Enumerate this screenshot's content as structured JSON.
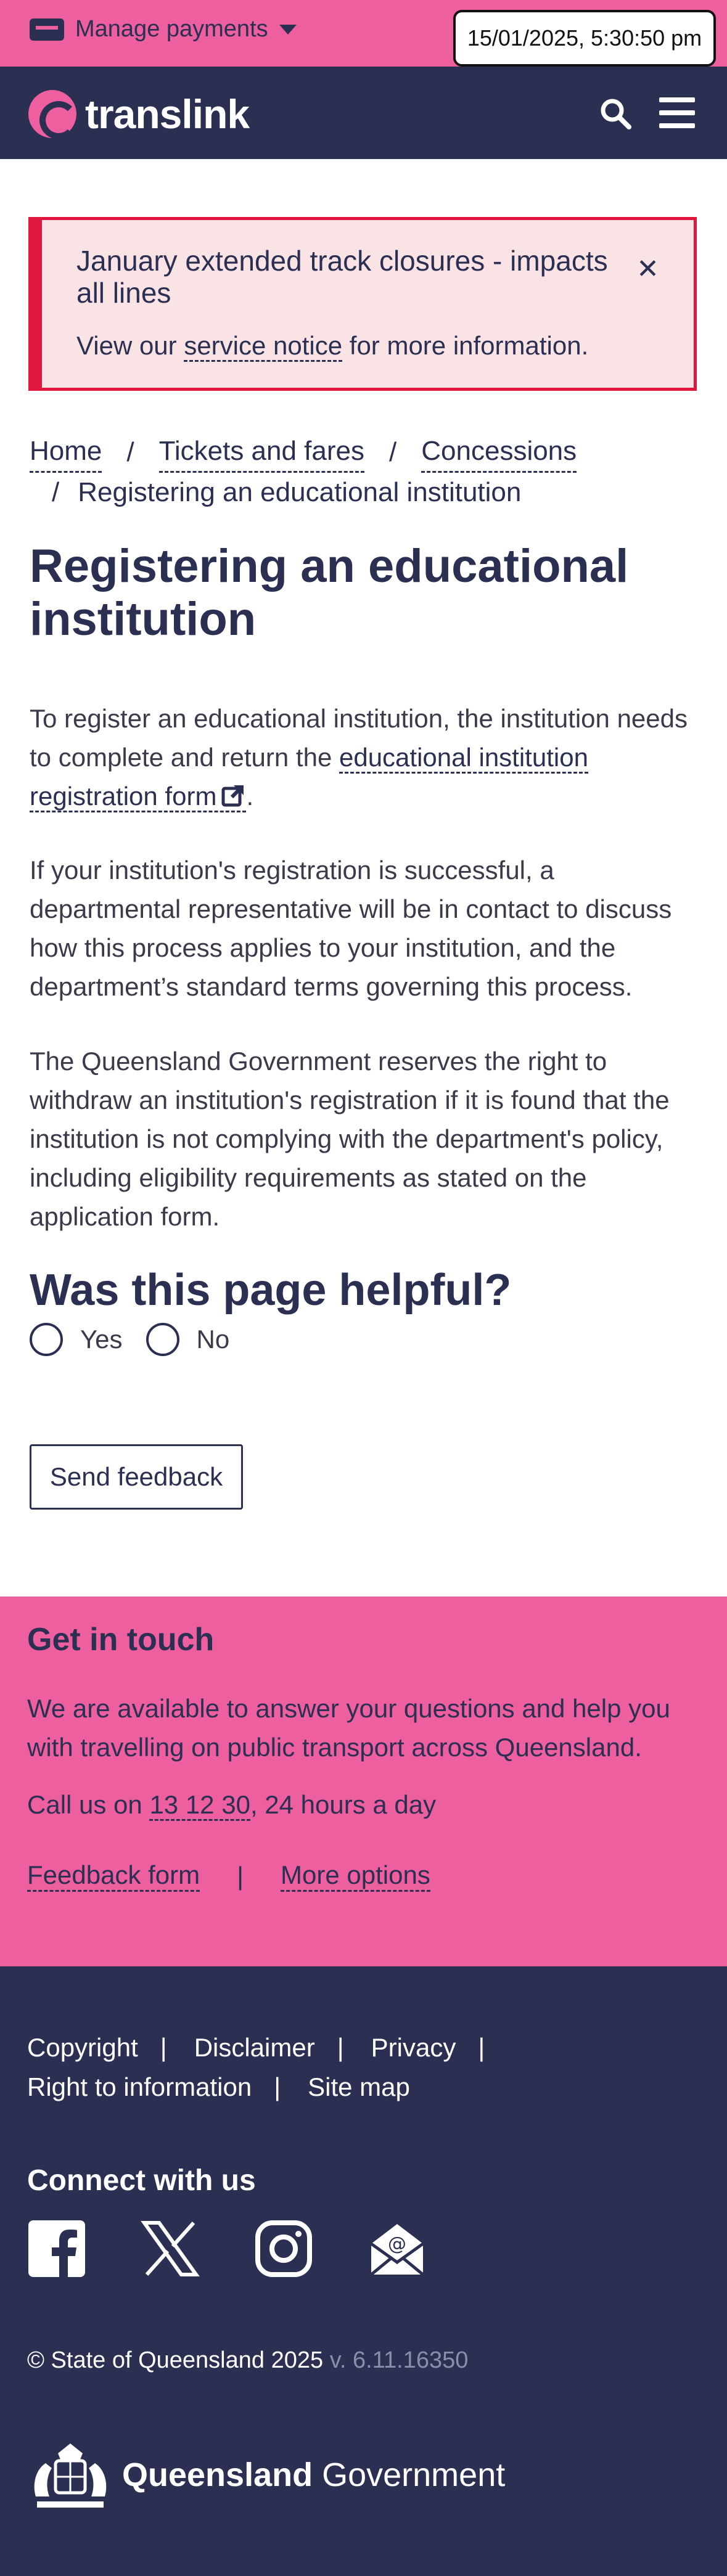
{
  "topbar": {
    "manage_label": "Manage payments",
    "datetime": "15/01/2025, 5:30:50 pm"
  },
  "header": {
    "brand": "translink"
  },
  "alert": {
    "title": "January extended track closures - impacts all lines",
    "body_prefix": "View our",
    "body_link": "service notice",
    "body_suffix": "for more information."
  },
  "breadcrumb": {
    "items": [
      "Home",
      "Tickets and fares",
      "Concessions"
    ],
    "current": "Registering an educational institution",
    "separator": "/"
  },
  "main": {
    "title": "Registering an educational institution",
    "para1_prefix": "To register an educational institution, the institution needs to complete and return the",
    "para1_link": "educational institution registration form",
    "para1_suffix": ".",
    "para2": "If your institution's registration is successful, a departmental representative will be in contact to discuss how this process applies to your institution, and the department’s standard terms governing this process.",
    "para3": "The Queensland Government reserves the right to withdraw an institution's registration if it is found that the institution is not complying with the department's policy, including eligibility requirements as stated on the application form."
  },
  "feedback": {
    "question": "Was this page helpful?",
    "yes": "Yes",
    "no": "No",
    "send": "Send feedback"
  },
  "touch": {
    "title": "Get in touch",
    "text": "We are available to answer your questions and help you with travelling on public transport across Queensland.",
    "call_prefix": "Call us on",
    "call_number": "13 12 30",
    "call_suffix": ", 24 hours a day",
    "link_feedback": "Feedback form",
    "link_sep": "|",
    "link_more": "More options"
  },
  "footer": {
    "links": [
      "Copyright",
      "Disclaimer",
      "Privacy",
      "Right to information",
      "Site map"
    ],
    "sep": "|",
    "connect": "Connect with us",
    "social_icons": [
      "facebook-icon",
      "x-icon",
      "instagram-icon",
      "email-icon"
    ],
    "copyright": "© State of Queensland 2025",
    "version": "v. 6.11.16350",
    "gov_bold": "Queensland",
    "gov_rest": "Government"
  },
  "colors": {
    "pink": "#ee5fa0",
    "navy": "#2b2f52",
    "alert_red": "#e0163e",
    "alert_bg": "#f9e3e5"
  }
}
